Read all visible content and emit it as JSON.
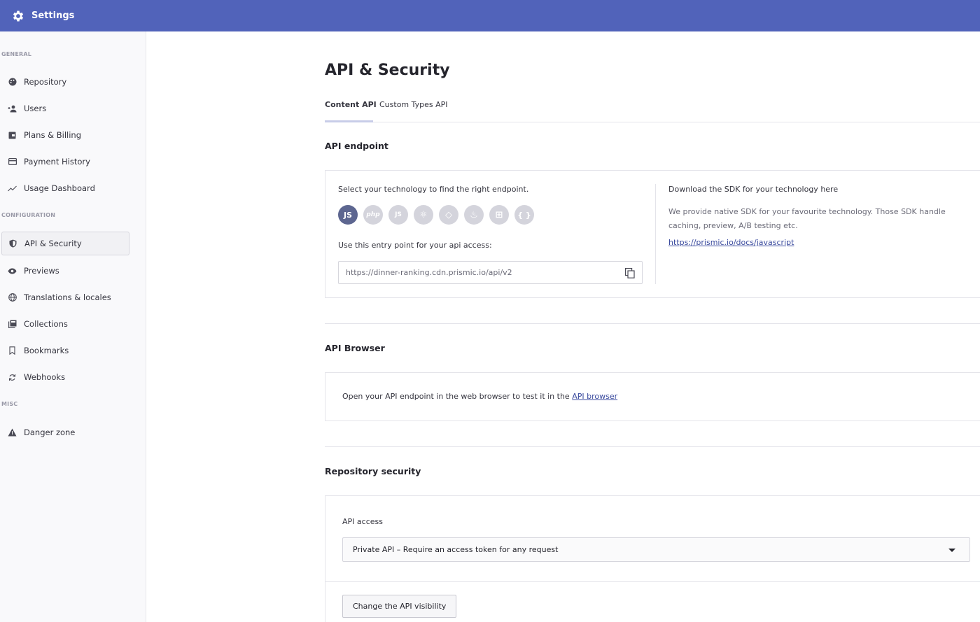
{
  "header": {
    "title": "Settings",
    "icon": "gear-icon"
  },
  "sidebar": {
    "sections": {
      "general": "GENERAL",
      "configuration": "CONFIGURATION",
      "misc": "MISC"
    },
    "items": [
      {
        "label": "Repository",
        "icon": "palette-icon"
      },
      {
        "label": "Users",
        "icon": "add-user-icon"
      },
      {
        "label": "Plans & Billing",
        "icon": "wallet-icon"
      },
      {
        "label": "Payment History",
        "icon": "credit-card-icon"
      },
      {
        "label": "Usage Dashboard",
        "icon": "trend-line-icon"
      },
      {
        "label": "API & Security",
        "icon": "shield-icon",
        "active": true
      },
      {
        "label": "Previews",
        "icon": "eye-icon"
      },
      {
        "label": "Translations & locales",
        "icon": "globe-icon"
      },
      {
        "label": "Collections",
        "icon": "collections-icon"
      },
      {
        "label": "Bookmarks",
        "icon": "bookmark-icon"
      },
      {
        "label": "Webhooks",
        "icon": "sync-icon"
      },
      {
        "label": "Danger zone",
        "icon": "warning-icon"
      }
    ]
  },
  "main": {
    "title": "API & Security",
    "tabs": [
      {
        "label": "Content API",
        "active": true
      },
      {
        "label": "Custom Types API"
      }
    ],
    "api_endpoint": {
      "heading": "API endpoint",
      "select_text": "Select your technology to find the right endpoint.",
      "technologies": [
        {
          "label": "JS",
          "icon": "javascript-icon",
          "active": true
        },
        {
          "label": "php",
          "icon": "php-icon"
        },
        {
          "label": "JS",
          "icon": "nodejs-icon"
        },
        {
          "label": "⚛",
          "icon": "react-icon"
        },
        {
          "label": "◇",
          "icon": "ruby-icon"
        },
        {
          "label": "♨",
          "icon": "java-icon"
        },
        {
          "label": "⊞",
          "icon": "dotnet-icon"
        },
        {
          "label": "{ }",
          "icon": "json-icon"
        }
      ],
      "entry_point_label": "Use this entry point for your api access:",
      "endpoint_url": "https://dinner-ranking.cdn.prismic.io/api/v2",
      "sdk_title": "Download the SDK for your technology here",
      "sdk_description": "We provide native SDK for your favourite technology. Those SDK handle caching, preview, A/B testing etc.",
      "sdk_link": "https://prismic.io/docs/javascript"
    },
    "api_browser": {
      "heading": "API Browser",
      "text": "Open your API endpoint in the web browser to test it in the ",
      "link": "API browser"
    },
    "repository_security": {
      "heading": "Repository security",
      "api_access_label": "API access",
      "api_access_value": "Private API – Require an access token for any request",
      "change_button": "Change the API visibility"
    }
  },
  "colors": {
    "header_bg": "#5163ba",
    "accent": "#3a4a9e",
    "active_tech": "#5d6690"
  }
}
